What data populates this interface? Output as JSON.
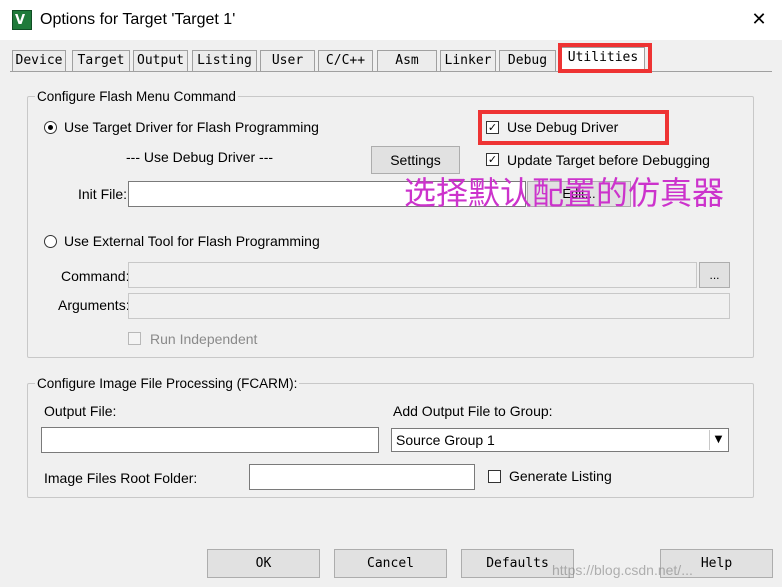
{
  "window": {
    "title": "Options for Target 'Target 1'"
  },
  "tabs": [
    {
      "label": "Device"
    },
    {
      "label": "Target"
    },
    {
      "label": "Output"
    },
    {
      "label": "Listing"
    },
    {
      "label": "User"
    },
    {
      "label": "C/C++"
    },
    {
      "label": "Asm"
    },
    {
      "label": "Linker"
    },
    {
      "label": "Debug"
    },
    {
      "label": "Utilities",
      "active": true
    }
  ],
  "flash": {
    "group_title": "Configure Flash Menu Command",
    "use_target_label": "Use Target Driver for Flash Programming",
    "debug_driver_note": "--- Use Debug Driver ---",
    "settings_button": "Settings",
    "use_debug_driver_label": "Use Debug Driver",
    "use_debug_driver_checked": true,
    "update_target_label": "Update Target before Debugging",
    "update_target_checked": true,
    "init_file_label": "Init File:",
    "init_file_value": "",
    "edit_button": "Edit...",
    "external_tool_label": "Use External Tool for Flash Programming",
    "command_label": "Command:",
    "command_value": "",
    "browse_button": "...",
    "arguments_label": "Arguments:",
    "arguments_value": "",
    "run_independent_label": "Run Independent",
    "selected_option": "use_target_driver"
  },
  "annotation": {
    "text": "选择默认配置的仿真器",
    "color": "#cc33cc"
  },
  "image": {
    "group_title": "Configure Image File Processing (FCARM):",
    "output_file_label": "Output File:",
    "output_file_value": "",
    "add_group_label": "Add Output File  to Group:",
    "group_selected": "Source Group 1",
    "root_folder_label": "Image Files Root Folder:",
    "root_folder_value": "",
    "generate_listing_label": "Generate Listing",
    "generate_listing_checked": false
  },
  "buttons": {
    "ok": "OK",
    "cancel": "Cancel",
    "defaults": "Defaults",
    "help": "Help"
  },
  "watermark": {
    "text": "https://blog.csdn.net/..."
  },
  "colors": {
    "highlight_red": "#ee3333",
    "annotation": "#cc33cc"
  },
  "icons": {
    "app": "keil-uvision-icon",
    "close": "close-icon"
  }
}
